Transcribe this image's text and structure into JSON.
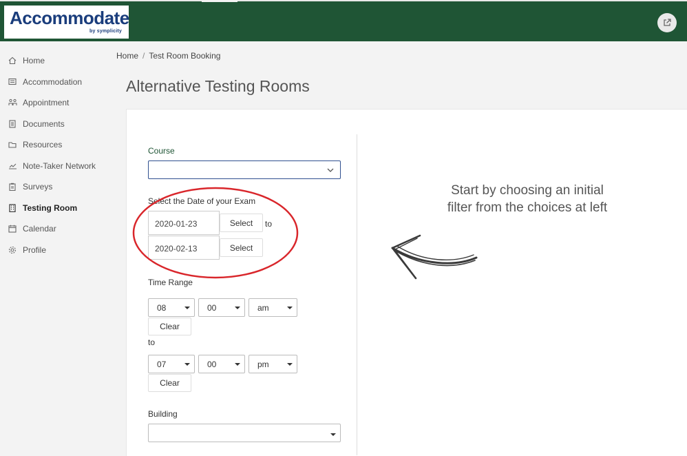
{
  "app": {
    "logo_text": "Accommodate",
    "logo_byline": "by symplicity"
  },
  "sidebar": {
    "items": [
      {
        "label": "Home",
        "icon": "home-icon"
      },
      {
        "label": "Accommodation",
        "icon": "comment-list-icon"
      },
      {
        "label": "Appointment",
        "icon": "people-icon"
      },
      {
        "label": "Documents",
        "icon": "documents-icon"
      },
      {
        "label": "Resources",
        "icon": "folder-icon"
      },
      {
        "label": "Note-Taker Network",
        "icon": "chart-icon"
      },
      {
        "label": "Surveys",
        "icon": "clipboard-icon"
      },
      {
        "label": "Testing Room",
        "icon": "building-icon",
        "active": true
      },
      {
        "label": "Calendar",
        "icon": "calendar-icon"
      },
      {
        "label": "Profile",
        "icon": "gear-icon"
      }
    ]
  },
  "breadcrumb": {
    "home": "Home",
    "separator": "/",
    "current": "Test Room Booking"
  },
  "page": {
    "title": "Alternative Testing Rooms"
  },
  "form": {
    "course_label": "Course",
    "course_value": "",
    "date_label": "Select the Date of your Exam",
    "date_from": "2020-01-23",
    "date_to": "2020-02-13",
    "select_label": "Select",
    "to_label": "to",
    "time_range_label": "Time Range",
    "start_time": {
      "hour": "08",
      "minute": "00",
      "ampm": "am"
    },
    "end_time": {
      "hour": "07",
      "minute": "00",
      "ampm": "pm"
    },
    "clear_label": "Clear",
    "time_to_label": "to",
    "building_label": "Building",
    "building_value": ""
  },
  "hint": {
    "text": "Start by choosing an initial filter from the choices at left"
  },
  "colors": {
    "header": "#1f5535",
    "annotation": "#d9262b"
  }
}
